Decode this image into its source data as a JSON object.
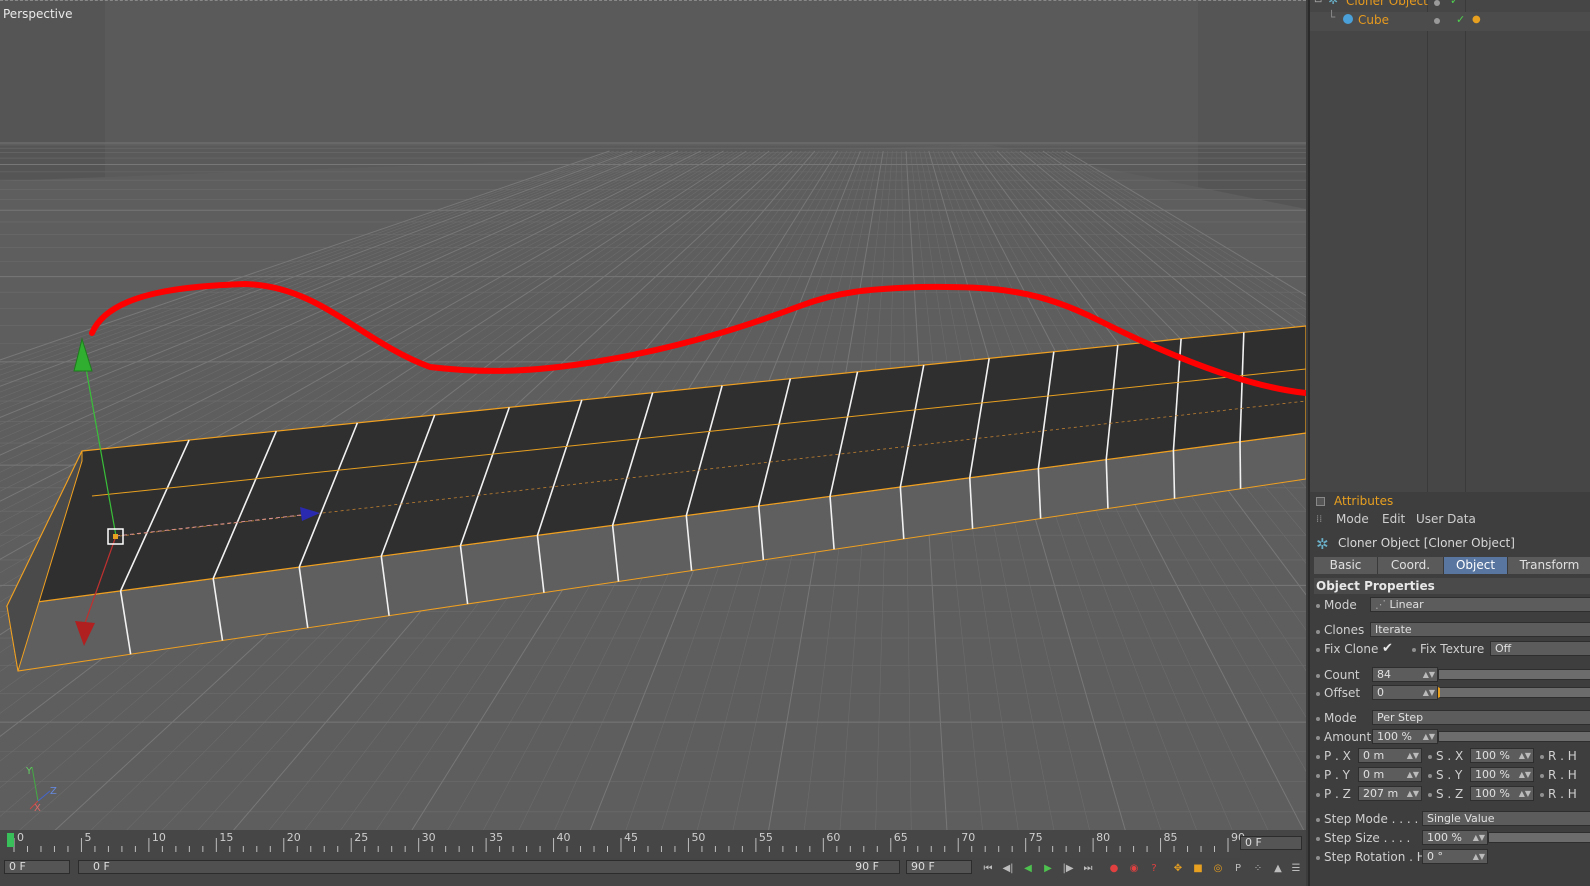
{
  "viewport": {
    "label": "Perspective"
  },
  "object_manager": {
    "items": [
      {
        "name": "Cloner Object"
      },
      {
        "name": "Cube"
      }
    ]
  },
  "attributes": {
    "title": "Attributes",
    "menu": [
      "Mode",
      "Edit",
      "User Data"
    ],
    "object_header": "Cloner Object [Cloner Object]",
    "tabs": [
      {
        "label": "Basic",
        "active": false
      },
      {
        "label": "Coord.",
        "active": false
      },
      {
        "label": "Object",
        "active": true
      },
      {
        "label": "Transform",
        "active": false
      }
    ],
    "section": "Object Properties",
    "mode_label": "Mode",
    "mode_value": "Linear",
    "clones_label": "Clones",
    "clones_value": "Iterate",
    "fix_clone_label": "Fix Clone",
    "fix_texture_label": "Fix Texture",
    "fix_texture_value": "Off",
    "count_label": "Count",
    "count_value": "84",
    "offset_label": "Offset",
    "offset_value": "0",
    "mode2_label": "Mode",
    "mode2_value": "Per Step",
    "amount_label": "Amount",
    "amount_value": "100 %",
    "px_label": "P . X",
    "px_value": "0 m",
    "py_label": "P . Y",
    "py_value": "0 m",
    "pz_label": "P . Z",
    "pz_value": "207 m",
    "sx_label": "S . X",
    "sx_value": "100 %",
    "sy_label": "S . Y",
    "sy_value": "100 %",
    "sz_label": "S . Z",
    "sz_value": "100 %",
    "r_label": "R . H",
    "step_mode_label": "Step Mode . . . . .",
    "step_mode_value": "Single Value",
    "step_size_label": "Step Size . . . .",
    "step_size_value": "100 %",
    "step_rotation_label": "Step Rotation . H",
    "step_rotation_value": "0 °"
  },
  "timeline": {
    "ticks": [
      "0",
      "5",
      "10",
      "15",
      "20",
      "25",
      "30",
      "35",
      "40",
      "45",
      "50",
      "55",
      "60",
      "65",
      "70",
      "75",
      "80",
      "85",
      "90"
    ],
    "current_frame": "0 F",
    "start_frame": "0 F",
    "range_start": "0 F",
    "range_end": "90 F",
    "end_frame": "90 F"
  },
  "colors": {
    "accent_orange": "#e79a1e",
    "selection_blue": "#5876a0",
    "annotation_red": "#ff0000"
  }
}
